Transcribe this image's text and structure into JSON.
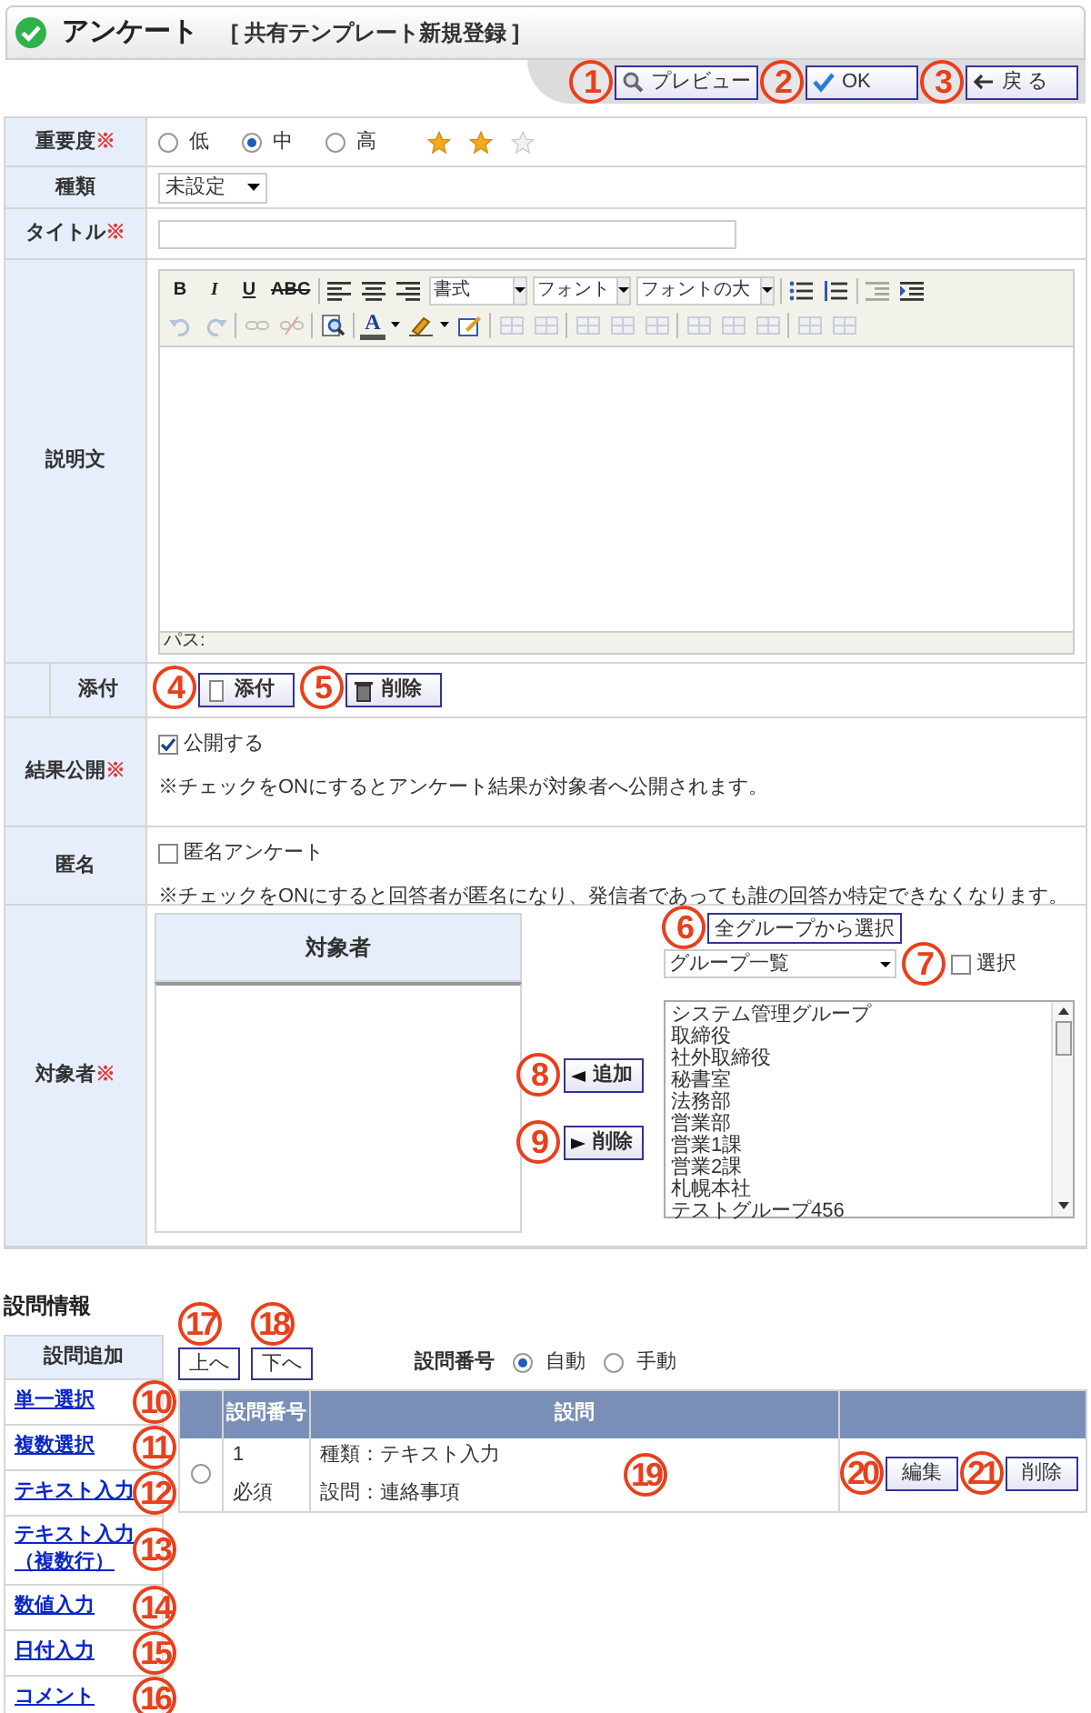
{
  "header": {
    "title": "アンケート",
    "subtitle": "[ 共有テンプレート新規登録 ]"
  },
  "toolbar_buttons": [
    {
      "label": "プレビュー",
      "kind": "preview",
      "marker": "1"
    },
    {
      "label": "OK",
      "kind": "ok",
      "marker": "2"
    },
    {
      "label": "戻 る",
      "kind": "back",
      "marker": "3"
    }
  ],
  "importance": {
    "label": "重要度",
    "required_mark": "※",
    "options": [
      {
        "label": "低",
        "selected": false
      },
      {
        "label": "中",
        "selected": true
      },
      {
        "label": "高",
        "selected": false
      }
    ],
    "stars": 2
  },
  "category": {
    "label": "種類",
    "value": "未設定"
  },
  "title_field": {
    "label": "タイトル",
    "required_mark": "※"
  },
  "description": {
    "label": "説明文",
    "format_buttons": [
      "B",
      "I",
      "U",
      "ABC"
    ],
    "selects": [
      "書式",
      "フォント",
      "フォントの大"
    ],
    "font_color_button": "A",
    "path_label": "パス:"
  },
  "attachment": {
    "label": "添付",
    "buttons": [
      {
        "label": "添付",
        "kind": "attach",
        "marker": "4"
      },
      {
        "label": "削除",
        "kind": "delete",
        "marker": "5"
      }
    ]
  },
  "publish": {
    "label": "結果公開",
    "required_mark": "※",
    "checkbox": {
      "label": "公開する",
      "checked": true
    },
    "note": "※チェックをONにするとアンケート結果が対象者へ公開されます。"
  },
  "anonymous": {
    "label": "匿名",
    "checkbox": {
      "label": "匿名アンケート",
      "checked": false
    },
    "note": "※チェックをONにすると回答者が匿名になり、発信者であっても誰の回答か特定できなくなります。"
  },
  "targets": {
    "label": "対象者",
    "required_mark": "※",
    "list_header": "対象者",
    "select_all_button": {
      "label": "全グループから選択",
      "marker": "6"
    },
    "group_select": "グループ一覧",
    "select_marker": "7",
    "select_checkbox": {
      "label": "選択",
      "checked": false
    },
    "add_button": {
      "label": "追加",
      "marker": "8"
    },
    "remove_button": {
      "label": "削除",
      "marker": "9"
    },
    "groups": [
      "システム管理グループ",
      "取締役",
      "社外取締役",
      "秘書室",
      "法務部",
      "営業部",
      "営業1課",
      "営業2課",
      "札幌本社",
      "テストグループ456"
    ]
  },
  "questions": {
    "heading": "設問情報",
    "sidebar_header": "設問追加",
    "add_links": [
      {
        "label": "単一選択",
        "marker": "10"
      },
      {
        "label": "複数選択",
        "marker": "11"
      },
      {
        "label": "テキスト入力",
        "marker": "12"
      },
      {
        "label": "テキスト入力（複数行）",
        "marker": "13"
      },
      {
        "label": "数値入力",
        "marker": "14"
      },
      {
        "label": "日付入力",
        "marker": "15"
      },
      {
        "label": "コメント",
        "marker": "16"
      }
    ],
    "move_buttons": [
      {
        "label": "上へ",
        "marker": "17"
      },
      {
        "label": "下へ",
        "marker": "18"
      }
    ],
    "numbering": {
      "label": "設問番号",
      "options": [
        {
          "label": "自動",
          "selected": true
        },
        {
          "label": "手動",
          "selected": false
        }
      ]
    },
    "columns": [
      "設問番号",
      "設問"
    ],
    "rows": [
      {
        "selected": false,
        "number": "1",
        "required": "必須",
        "type": "種類：テキスト入力",
        "question": "設問：連絡事項",
        "marker": "19",
        "edit": {
          "label": "編集",
          "marker": "20"
        },
        "delete": {
          "label": "削除",
          "marker": "21"
        }
      }
    ]
  }
}
